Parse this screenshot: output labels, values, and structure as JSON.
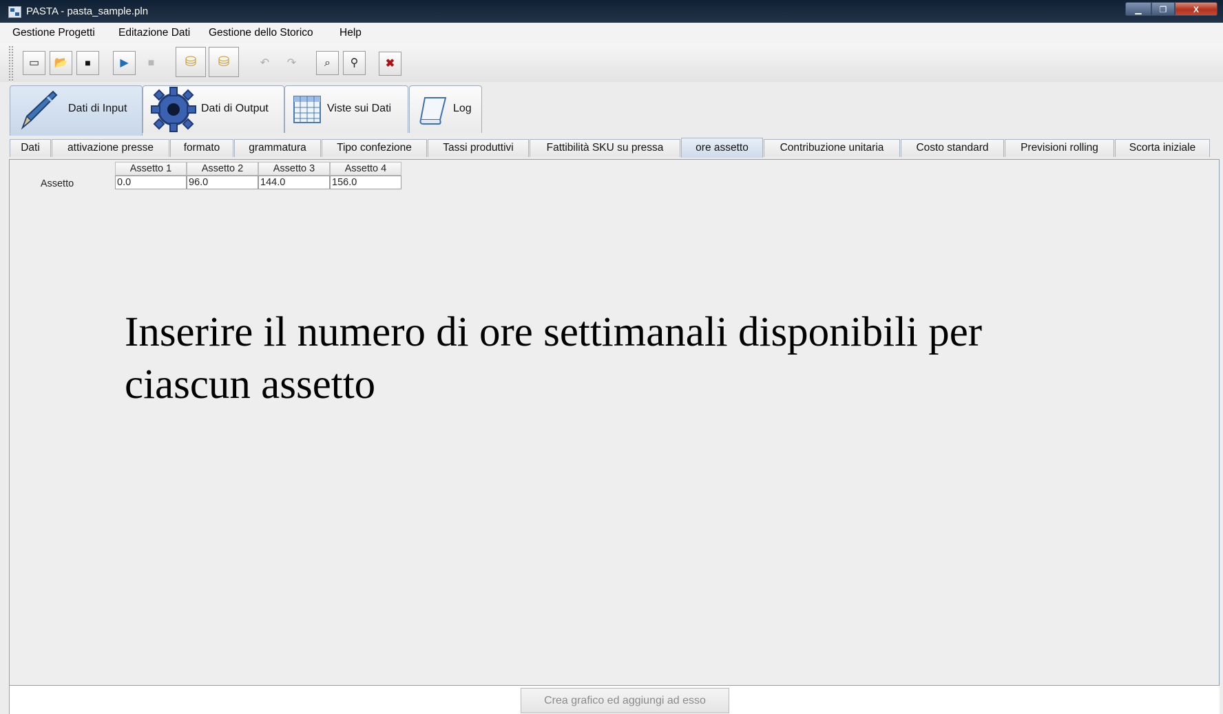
{
  "window": {
    "title": "PASTA - pasta_sample.pln",
    "minimize_icon": "minimize-icon",
    "maximize_icon": "maximize-icon",
    "close_icon": "close-icon",
    "close_glyph": "X"
  },
  "menubar": {
    "items": [
      "Gestione Progetti",
      "Editazione Dati",
      "Gestione dello Storico",
      "Help"
    ]
  },
  "toolbar": {
    "buttons": [
      {
        "icon": "new-project-icon",
        "glyph": "▭",
        "enabled": true
      },
      {
        "icon": "open-folder-icon",
        "glyph": "📂",
        "enabled": true
      },
      {
        "icon": "save-icon",
        "glyph": "■",
        "enabled": true
      },
      {
        "icon": "run-icon",
        "glyph": "▶",
        "enabled": true
      },
      {
        "icon": "stop-icon",
        "glyph": "■",
        "enabled": false
      },
      {
        "icon": "database-export-icon",
        "glyph": "⛁",
        "enabled": true
      },
      {
        "icon": "database-import-icon",
        "glyph": "⛁",
        "enabled": true
      },
      {
        "icon": "undo-icon",
        "glyph": "↶",
        "enabled": false
      },
      {
        "icon": "redo-icon",
        "glyph": "↷",
        "enabled": false
      },
      {
        "icon": "inspect-icon",
        "glyph": "⌕",
        "enabled": true
      },
      {
        "icon": "zoom-icon",
        "glyph": "⚲",
        "enabled": true
      },
      {
        "icon": "delete-icon",
        "glyph": "✖",
        "enabled": true
      }
    ],
    "delete_color": "#b01010"
  },
  "main_tabs": [
    {
      "label": "Dati di Input",
      "icon": "pen-icon",
      "active": true
    },
    {
      "label": "Dati di Output",
      "icon": "gear-icon",
      "active": false
    },
    {
      "label": "Viste sui Dati",
      "icon": "table-icon",
      "active": false
    },
    {
      "label": "Log",
      "icon": "scroll-icon",
      "active": false
    }
  ],
  "sub_tabs": [
    {
      "label": "Dati",
      "active": false
    },
    {
      "label": "attivazione presse",
      "active": false
    },
    {
      "label": "formato",
      "active": false
    },
    {
      "label": "grammatura",
      "active": false
    },
    {
      "label": "Tipo confezione",
      "active": false
    },
    {
      "label": "Tassi produttivi",
      "active": false
    },
    {
      "label": "Fattibilità SKU su pressa",
      "active": false
    },
    {
      "label": "ore assetto",
      "active": true
    },
    {
      "label": "Contribuzione unitaria",
      "active": false
    },
    {
      "label": "Costo standard",
      "active": false
    },
    {
      "label": "Previsioni rolling",
      "active": false
    },
    {
      "label": "Scorta iniziale",
      "active": false
    }
  ],
  "table": {
    "columns": [
      "Assetto 1",
      "Assetto 2",
      "Assetto 3",
      "Assetto 4"
    ],
    "row_header": "Assetto",
    "values": [
      "0.0",
      "96.0",
      "144.0",
      "156.0"
    ]
  },
  "note": {
    "line1": "Inserire il numero di ore settimanali disponibili per",
    "line2": "ciascun assetto"
  },
  "bottom": {
    "chart_button": "Crea grafico ed aggiungi ad esso"
  }
}
